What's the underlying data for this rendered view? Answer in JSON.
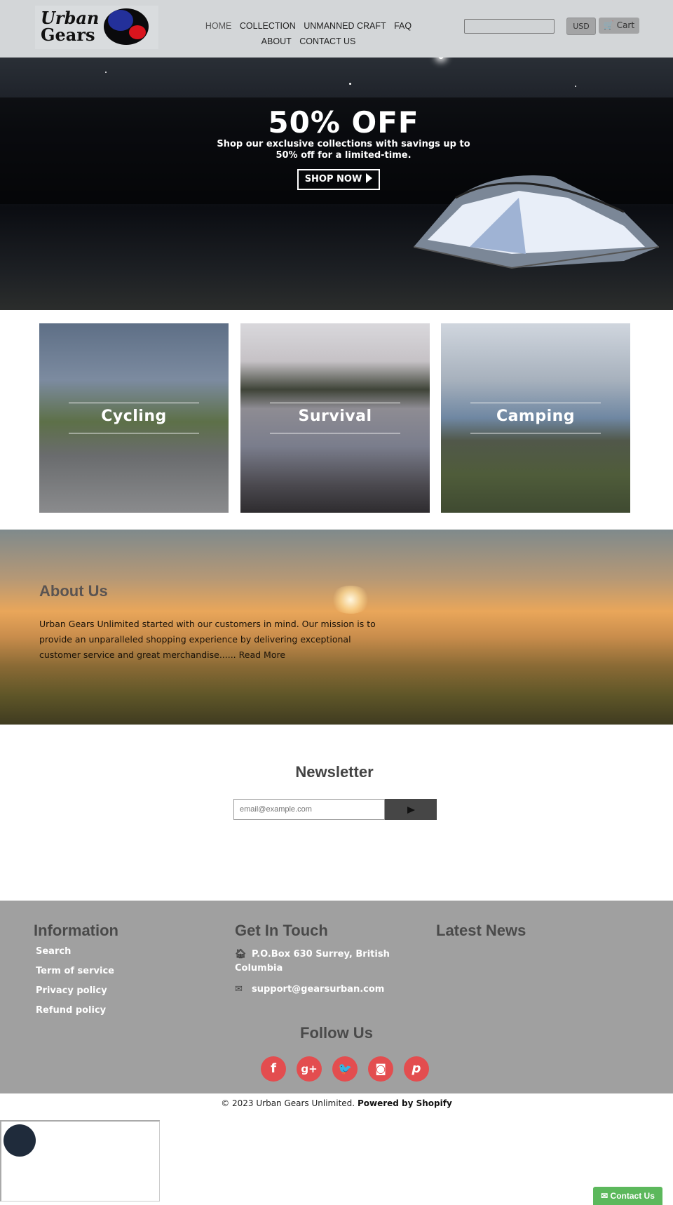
{
  "header": {
    "logo_line1": "Urban",
    "logo_line2": "Gears",
    "nav": [
      {
        "label": "HOME",
        "active": true
      },
      {
        "label": "COLLECTION"
      },
      {
        "label": "UNMANNED CRAFT"
      },
      {
        "label": "FAQ"
      },
      {
        "label": "ABOUT"
      },
      {
        "label": "CONTACT US"
      }
    ],
    "search_value": "",
    "currency": "USD",
    "cart_label": "Cart",
    "cart_icon": "shopping-cart-icon"
  },
  "hero": {
    "title": "50% OFF",
    "subtitle": "Shop our exclusive collections with savings up to 50% off for a limited-time.",
    "button_label": "SHOP NOW",
    "button_icon": "play-triangle-icon"
  },
  "categories": [
    {
      "label": "Cycling"
    },
    {
      "label": "Survival"
    },
    {
      "label": "Camping"
    }
  ],
  "about": {
    "title": "About Us",
    "text": "Urban Gears Unlimited started with our customers in mind. Our mission is to provide an unparalleled shopping experience by delivering exceptional customer service and great merchandise......",
    "read_more": "Read More"
  },
  "newsletter": {
    "title": "Newsletter",
    "placeholder": "email@example.com",
    "submit_icon": "send-arrow-icon"
  },
  "footer": {
    "information": {
      "title": "Information",
      "links": [
        "Search",
        "Term of service",
        "Privacy policy",
        "Refund policy"
      ]
    },
    "contact": {
      "title": "Get In Touch",
      "address": "P.O.Box 630 Surrey, British Columbia",
      "address_icon": "home-icon",
      "email": "support@gearsurban.com",
      "email_icon": "envelope-icon"
    },
    "news": {
      "title": "Latest News"
    },
    "follow": {
      "title": "Follow Us",
      "networks": [
        {
          "name": "facebook",
          "glyph": "f"
        },
        {
          "name": "google-plus",
          "glyph": "g+"
        },
        {
          "name": "twitter",
          "glyph": "🐦"
        },
        {
          "name": "instagram",
          "glyph": "◙"
        },
        {
          "name": "pinterest",
          "glyph": "p"
        }
      ],
      "color": "#e34d4f"
    }
  },
  "copyright": {
    "text": "© 2023 Urban Gears Unlimited.",
    "powered": "Powered by Shopify"
  },
  "contact_tab": {
    "label": "Contact Us",
    "icon": "envelope-icon",
    "color": "#5cb85c"
  }
}
